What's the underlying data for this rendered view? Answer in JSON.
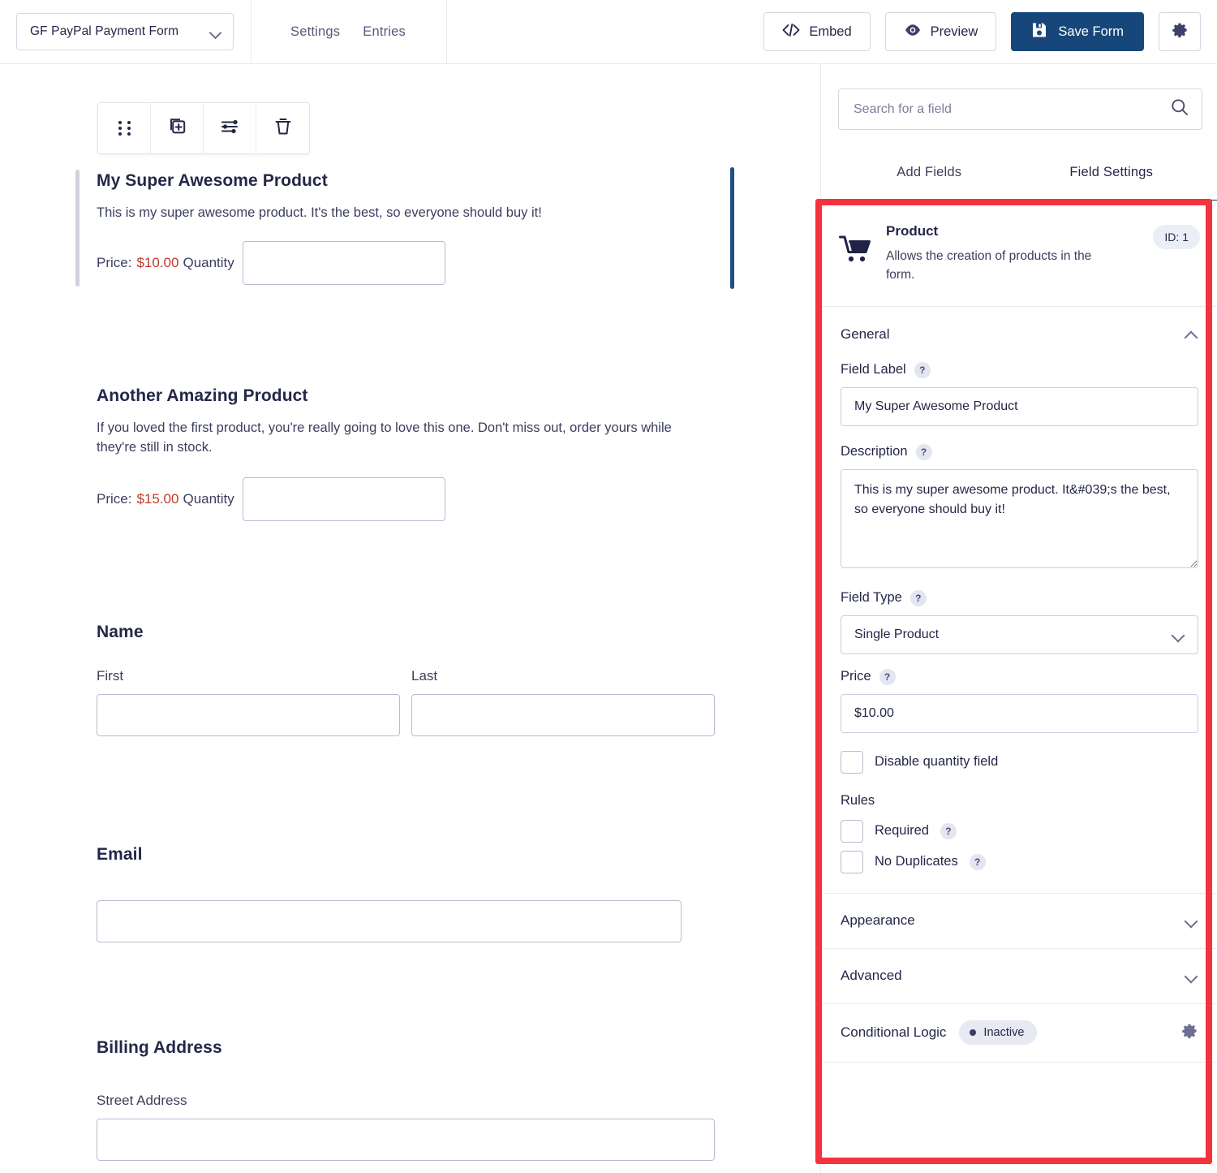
{
  "topbar": {
    "form_name": "GF PayPal Payment Form",
    "nav": [
      {
        "label": "Settings"
      },
      {
        "label": "Entries"
      }
    ],
    "actions": {
      "embed": "Embed",
      "preview": "Preview",
      "save": "Save Form"
    }
  },
  "canvas": {
    "selected_field": {
      "title": "My Super Awesome Product",
      "description": "This is my super awesome product. It's the best, so everyone should buy it!",
      "price_label": "Price:",
      "price": "$10.00",
      "quantity_label": "Quantity",
      "quantity_value": ""
    },
    "second_field": {
      "title": "Another Amazing Product",
      "description": "If you loved the first product, you're really going to love this one. Don't miss out, order yours while they're still in stock.",
      "price_label": "Price:",
      "price": "$15.00",
      "quantity_label": "Quantity",
      "quantity_value": ""
    },
    "name_field": {
      "title": "Name",
      "first_label": "First",
      "first_value": "",
      "last_label": "Last",
      "last_value": ""
    },
    "email_field": {
      "title": "Email",
      "value": ""
    },
    "address_field": {
      "title": "Billing Address",
      "street_label": "Street Address",
      "street_value": ""
    }
  },
  "panel": {
    "search": {
      "placeholder": "Search for a field",
      "value": ""
    },
    "tabs": [
      {
        "label": "Add Fields",
        "active": false
      },
      {
        "label": "Field Settings",
        "active": true
      }
    ],
    "field_header": {
      "title": "Product",
      "description": "Allows the creation of products in the form.",
      "id_badge": "ID: 1",
      "icon": "shopping-cart-icon"
    },
    "general": {
      "section_label": "General",
      "field_label": {
        "label": "Field Label",
        "value": "My Super Awesome Product"
      },
      "description": {
        "label": "Description",
        "value": "This is my super awesome product. It&#039;s the best, so everyone should buy it!"
      },
      "field_type": {
        "label": "Field Type",
        "value": "Single Product"
      },
      "price": {
        "label": "Price",
        "value": "$10.00"
      },
      "disable_quantity": {
        "label": "Disable quantity field",
        "checked": false
      },
      "rules_label": "Rules",
      "rules": [
        {
          "label": "Required",
          "checked": false
        },
        {
          "label": "No Duplicates",
          "checked": false
        }
      ]
    },
    "appearance": {
      "label": "Appearance"
    },
    "advanced": {
      "label": "Advanced"
    },
    "conditional_logic": {
      "label": "Conditional Logic",
      "status": "Inactive"
    }
  },
  "colors": {
    "primary": "#17477a",
    "highlight": "#f5333f",
    "price_red": "#c0392b",
    "selected_bar": "#1d5186",
    "text": "#242748"
  }
}
